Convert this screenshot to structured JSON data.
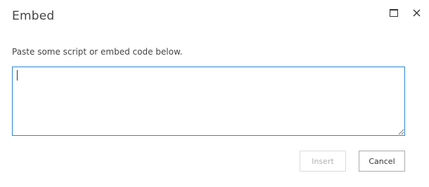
{
  "dialog": {
    "title": "Embed",
    "maximize_icon": "maximize-icon",
    "close_icon": "close-icon",
    "close_glyph": "✕",
    "instruction": "Paste some script or embed code below.",
    "code_value": "",
    "code_placeholder": "",
    "insert_label": "Insert",
    "insert_enabled": false,
    "cancel_label": "Cancel",
    "accent_color": "#2b88d8"
  }
}
